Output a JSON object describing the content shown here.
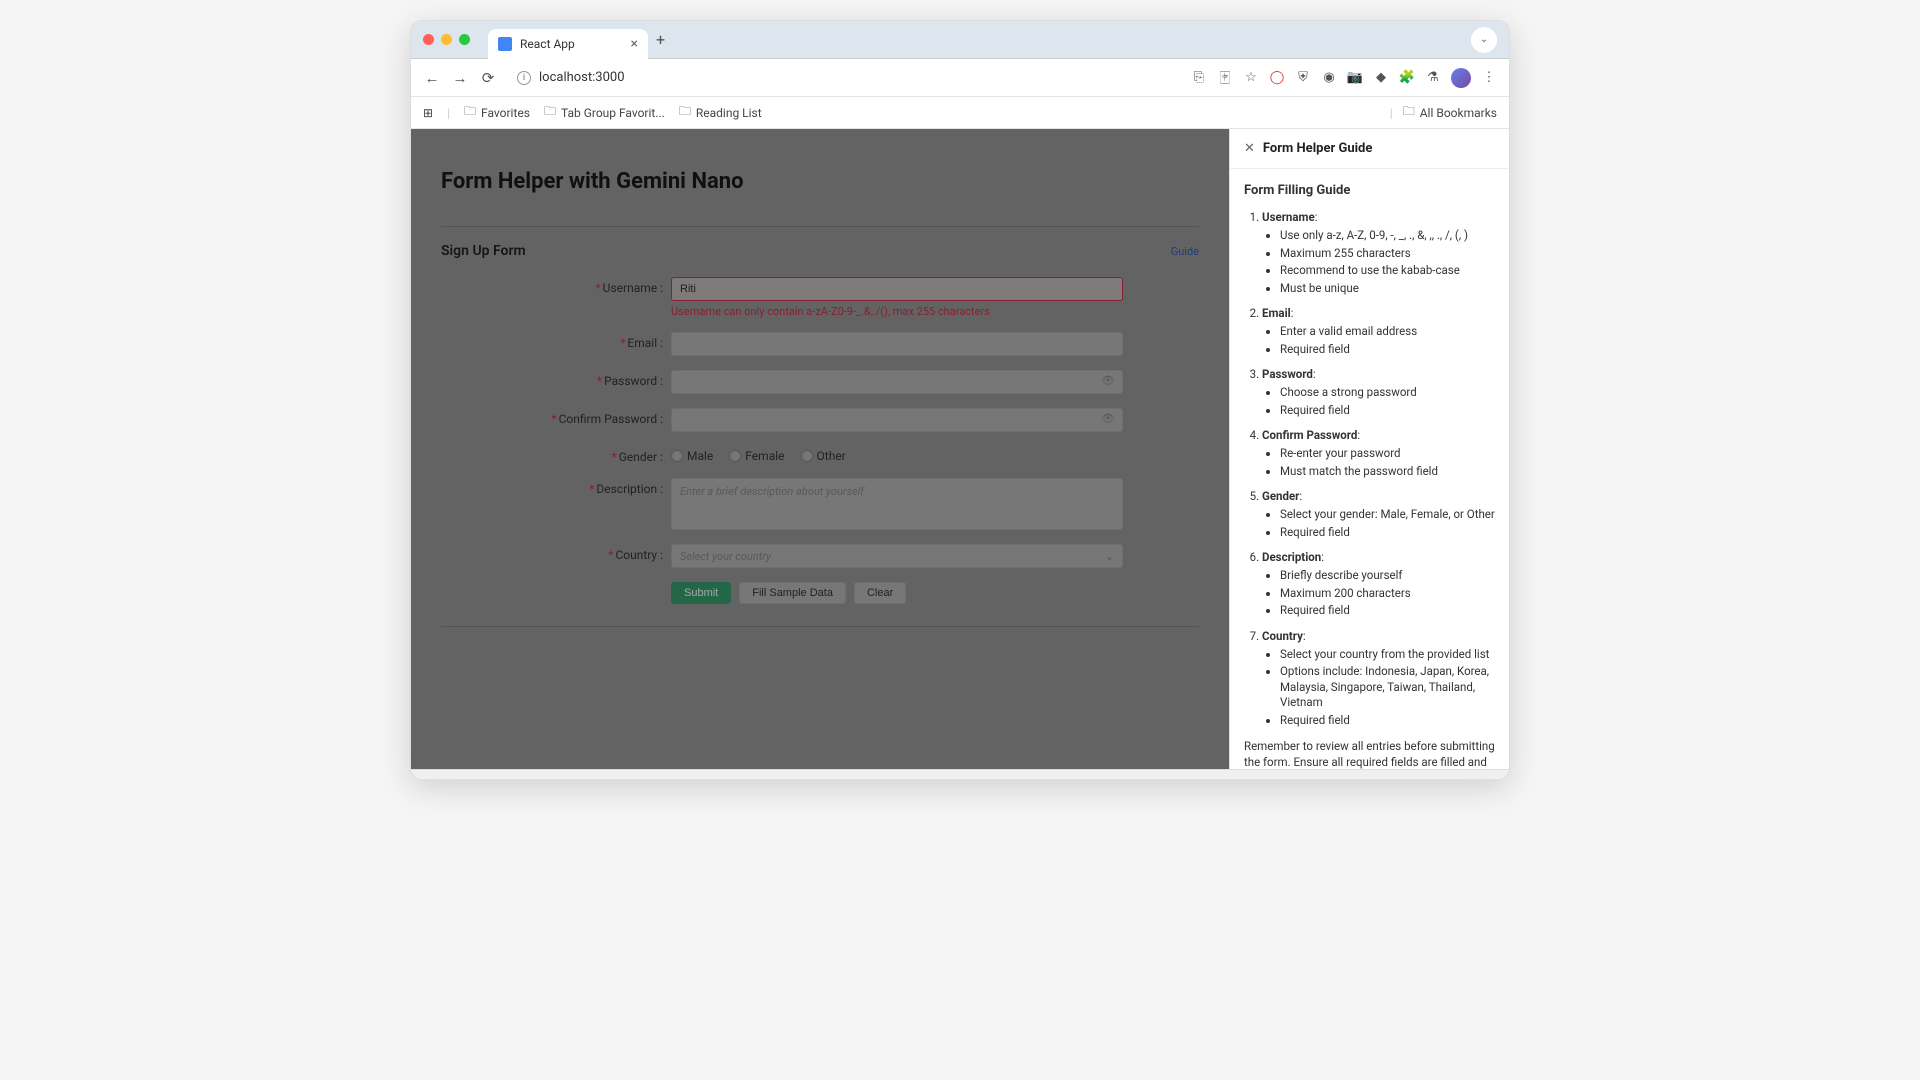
{
  "browser": {
    "tab_title": "React App",
    "url": "localhost:3000",
    "bookmarks": {
      "favorites": "Favorites",
      "tabgroup": "Tab Group Favorit...",
      "reading": "Reading List",
      "all": "All Bookmarks"
    }
  },
  "page": {
    "title": "Form Helper with Gemini Nano",
    "form_title": "Sign Up Form",
    "guide_link": "Guide",
    "fields": {
      "username_label": "Username :",
      "username_value": "Riti",
      "username_error": "Username can only contain a-zA-Z0-9-_.&,./(), max 255 characters",
      "email_label": "Email :",
      "password_label": "Password :",
      "confirm_label": "Confirm Password :",
      "gender_label": "Gender :",
      "gender_male": "Male",
      "gender_female": "Female",
      "gender_other": "Other",
      "description_label": "Description :",
      "description_placeholder": "Enter a brief description about yourself",
      "country_label": "Country :",
      "country_placeholder": "Select your country"
    },
    "buttons": {
      "submit": "Submit",
      "fill": "Fill Sample Data",
      "clear": "Clear"
    }
  },
  "guide": {
    "panel_title": "Form Helper Guide",
    "heading": "Form Filling Guide",
    "items": [
      {
        "title": "Username",
        "rules": [
          "Use only a-z, A-Z, 0-9, -, _, ., &, ,, ., /, (, )",
          "Maximum 255 characters",
          "Recommend to use the kabab-case",
          "Must be unique"
        ]
      },
      {
        "title": "Email",
        "rules": [
          "Enter a valid email address",
          "Required field"
        ]
      },
      {
        "title": "Password",
        "rules": [
          "Choose a strong password",
          "Required field"
        ]
      },
      {
        "title": "Confirm Password",
        "rules": [
          "Re-enter your password",
          "Must match the password field"
        ]
      },
      {
        "title": "Gender",
        "rules": [
          "Select your gender: Male, Female, or Other",
          "Required field"
        ]
      },
      {
        "title": "Description",
        "rules": [
          "Briefly describe yourself",
          "Maximum 200 characters",
          "Required field"
        ]
      },
      {
        "title": "Country",
        "rules": [
          "Select your country from the provided list",
          "Options include: Indonesia, Japan, Korea, Malaysia, Singapore, Taiwan, Thailand, Vietnam",
          "Required field"
        ]
      }
    ],
    "footer": "Remember to review all entries before submitting the form. Ensure all required fields are filled and meet the specified criteria."
  }
}
